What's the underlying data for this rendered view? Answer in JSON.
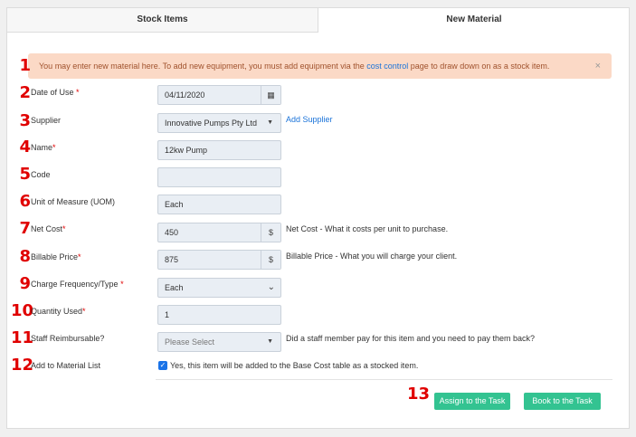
{
  "tabs": [
    "Stock Items",
    "New Material"
  ],
  "alert": {
    "text_before": "You may enter new material here. To add new equipment, you must add equipment via the ",
    "link": "cost control",
    "text_after": " page to draw down on as a stock item.",
    "close": "×"
  },
  "markers": [
    "1",
    "2",
    "3",
    "4",
    "5",
    "6",
    "7",
    "8",
    "9",
    "10",
    "11",
    "12",
    "13"
  ],
  "form": {
    "date_label": "Date of Use",
    "date_value": "04/11/2020",
    "supplier_label": "Supplier",
    "supplier_value": "Innovative Pumps Pty Ltd",
    "add_supplier": "Add Supplier",
    "name_label": "Name",
    "name_value": "12kw Pump",
    "code_label": "Code",
    "code_value": "",
    "uom_label": "Unit of Measure (UOM)",
    "uom_value": "Each",
    "net_cost_label": "Net Cost",
    "net_cost_value": "450",
    "net_cost_addon": "$",
    "net_cost_help": "Net Cost - What it costs per unit to purchase.",
    "billable_label": "Billable Price",
    "billable_value": "875",
    "billable_addon": "$",
    "billable_help": "Billable Price - What you will charge your client.",
    "charge_label": "Charge Frequency/Type",
    "charge_value": "Each",
    "qty_label": "Quantity Used",
    "qty_value": "1",
    "staff_label": "Staff Reimbursable?",
    "staff_placeholder": "Please Select",
    "staff_help": "Did a staff member pay for this item and you need to pay them back?",
    "add_list_label": "Add to Material List",
    "add_list_checkbox": "Yes, this item will be added to the Base Cost table as a stocked item."
  },
  "buttons": {
    "assign": "Assign to the Task",
    "book": "Book to the Task"
  },
  "colors": {
    "accent": "#33c391",
    "marker": "#e00000",
    "link": "#1a73d9",
    "alert_bg": "#fbd9c6"
  }
}
